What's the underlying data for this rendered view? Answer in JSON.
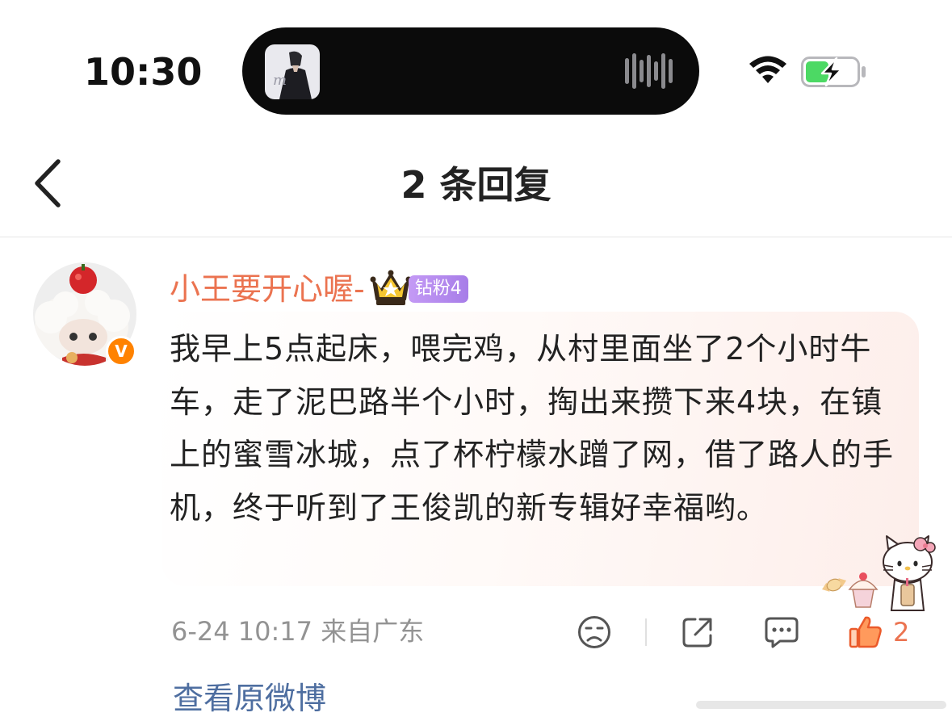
{
  "status_bar": {
    "time": "10:30",
    "wifi_icon": "wifi-icon",
    "battery_icon": "battery-charging-icon",
    "battery_color": "#4cd964"
  },
  "header": {
    "title": "2 条回复",
    "back_icon": "chevron-left-icon"
  },
  "comment": {
    "username": "小王要开心喔-",
    "badge_text": "钻粉4",
    "verified_text": "V",
    "text": "我早上5点起床，喂完鸡，从村里面坐了2个小时牛车，走了泥巴路半个小时，掏出来攒下来4块，在镇上的蜜雪冰城，点了杯柠檬水蹭了网，借了路人的手机，终于听到了王俊凯的新专辑好幸福哟。",
    "meta": "6-24 10:17  来自广东",
    "like_count": "2",
    "username_color": "#eb7350",
    "link_color": "#4e6ea0"
  },
  "footer": {
    "view_original": "查看原微博"
  }
}
